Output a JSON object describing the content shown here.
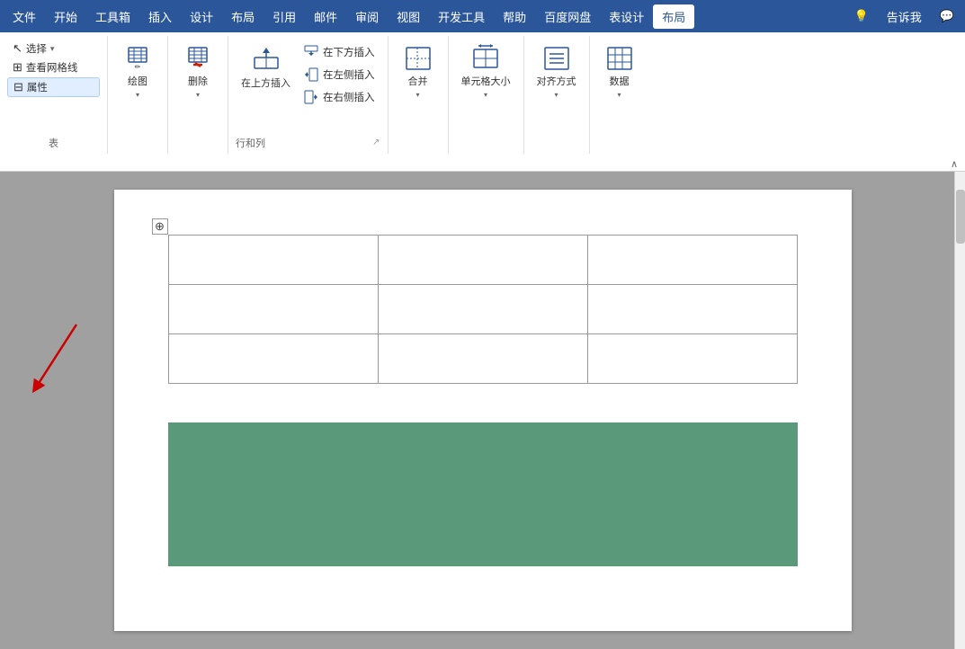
{
  "menubar": {
    "items": [
      "文件",
      "开始",
      "工具箱",
      "插入",
      "设计",
      "布局",
      "引用",
      "邮件",
      "审阅",
      "视图",
      "开发工具",
      "帮助",
      "百度网盘",
      "表设计",
      "布局"
    ],
    "active_index": 14,
    "right_icons": [
      "💡",
      "告诉我",
      "💬"
    ]
  },
  "ribbon": {
    "groups": {
      "table": {
        "label": "表",
        "buttons": [
          {
            "id": "select",
            "label": "选择",
            "has_dropdown": true
          },
          {
            "id": "gridlines",
            "label": "查看网格线",
            "has_dropdown": false
          },
          {
            "id": "properties",
            "label": "属性",
            "has_dropdown": false
          }
        ]
      },
      "draw": {
        "label": "绘图",
        "icon": "✏️"
      },
      "delete": {
        "label": "删除",
        "icon": "🗑️"
      },
      "rows_cols": {
        "label": "行和列",
        "insert_above": "在上方插入",
        "insert_below": "在下方插入",
        "insert_left": "在左侧插入",
        "insert_right": "在右侧插入",
        "dialog_icon": "↗"
      },
      "merge": {
        "label": "合并",
        "icon": "⊞"
      },
      "cell_size": {
        "label": "单元格大小",
        "icon": "⊟"
      },
      "alignment": {
        "label": "对齐方式",
        "icon": "≡"
      },
      "data": {
        "label": "数据",
        "icon": "📊"
      }
    },
    "collapse_btn": "∧"
  },
  "table": {
    "rows": 3,
    "cols": 3,
    "move_handle": "⊕"
  },
  "colors": {
    "menu_bg": "#2b579a",
    "active_tab": "#ffffff",
    "ribbon_bg": "#ffffff",
    "doc_bg": "#939393",
    "table_border": "#999999",
    "green_image": "#5a9a7a",
    "arrow_color": "#cc0000"
  }
}
